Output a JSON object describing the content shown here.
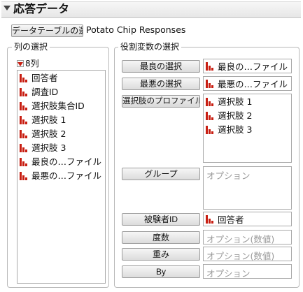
{
  "header": {
    "title": "応答データ"
  },
  "data_table": {
    "button_label": "データテーブルの選択",
    "table_name": "Potato Chip Responses"
  },
  "columns_panel": {
    "title": "列の選択",
    "count_label": "8列",
    "items": [
      {
        "label": "回答者",
        "icon": "nominal-bar-icon"
      },
      {
        "label": "調査ID",
        "icon": "nominal-bar-icon"
      },
      {
        "label": "選択肢集合ID",
        "icon": "nominal-bar-icon"
      },
      {
        "label": "選択肢 1",
        "icon": "nominal-bar-icon"
      },
      {
        "label": "選択肢 2",
        "icon": "nominal-bar-icon"
      },
      {
        "label": "選択肢 3",
        "icon": "nominal-bar-icon"
      },
      {
        "label": "最良の…ファイル",
        "icon": "nominal-bar-icon"
      },
      {
        "label": "最悪の…ファイル",
        "icon": "nominal-bar-icon"
      }
    ]
  },
  "roles_panel": {
    "title": "役割変数の選択",
    "best": {
      "button": "最良の選択",
      "value": "最良の…ファイル"
    },
    "worst": {
      "button": "最悪の選択",
      "value": "最悪の…ファイル"
    },
    "profile": {
      "button": "選択肢のプロファイルID",
      "values": [
        "選択肢 1",
        "選択肢 2",
        "選択肢 3"
      ]
    },
    "group": {
      "button": "グループ",
      "placeholder": "オプション"
    },
    "subject": {
      "button": "被験者ID",
      "value": "回答者"
    },
    "freq": {
      "button": "度数",
      "placeholder": "オプション(数値)"
    },
    "weight": {
      "button": "重み",
      "placeholder": "オプション(数値)"
    },
    "by": {
      "button": "By",
      "placeholder": "オプション"
    }
  },
  "colors": {
    "nominal_icon": "#c81e12",
    "group_border": "#b8b8b8"
  }
}
